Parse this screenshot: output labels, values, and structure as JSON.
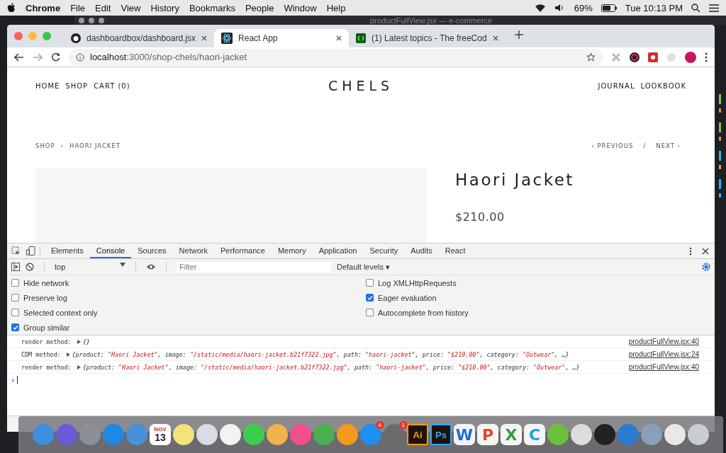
{
  "menubar": {
    "app": "Chrome",
    "items": [
      "File",
      "Edit",
      "View",
      "History",
      "Bookmarks",
      "People",
      "Window",
      "Help"
    ],
    "battery": "69%",
    "clock": "Tue 10:13 PM"
  },
  "background_window": {
    "title": "productFullView.jsx — e-commerce"
  },
  "browser": {
    "tabs": [
      {
        "title": "dashboardbox/dashboard.jsx",
        "selected": false
      },
      {
        "title": "React App",
        "selected": true
      },
      {
        "title": "(1) Latest topics - The freeCod",
        "selected": false
      }
    ],
    "url_host": "localhost",
    "url_path": ":3000/shop-chels/haori-jacket"
  },
  "page": {
    "nav_left": [
      "HOME",
      "SHOP",
      "CART (0)"
    ],
    "logo": "CHELS",
    "nav_right": [
      "JOURNAL",
      "LOOKBOOK"
    ],
    "breadcrumb": [
      "SHOP",
      "HAORI JACKET"
    ],
    "breadcrumb_sep": "›",
    "previous": "‹ PREVIOUS",
    "pager_sep": "/",
    "next": "NEXT ›",
    "product": {
      "name": "Haori Jacket",
      "price": "$210.00"
    }
  },
  "devtools": {
    "tabs": [
      {
        "label": "Elements",
        "selected": false
      },
      {
        "label": "Console",
        "selected": true
      },
      {
        "label": "Sources",
        "selected": false
      },
      {
        "label": "Network",
        "selected": false
      },
      {
        "label": "Performance",
        "selected": false
      },
      {
        "label": "Memory",
        "selected": false
      },
      {
        "label": "Application",
        "selected": false
      },
      {
        "label": "Security",
        "selected": false
      },
      {
        "label": "Audits",
        "selected": false
      },
      {
        "label": "React",
        "selected": false
      }
    ],
    "context": "top",
    "filter_placeholder": "Filter",
    "levels": "Default levels ▾",
    "settings_left": [
      {
        "label": "Hide network",
        "checked": false
      },
      {
        "label": "Preserve log",
        "checked": false
      },
      {
        "label": "Selected context only",
        "checked": false
      },
      {
        "label": "Group similar",
        "checked": true
      }
    ],
    "settings_right": [
      {
        "label": "Log XMLHttpRequests",
        "checked": false
      },
      {
        "label": "Eager evaluation",
        "checked": true
      },
      {
        "label": "Autocomplete from history",
        "checked": false
      }
    ],
    "logs": [
      {
        "prefix": "render method: ",
        "segments": [
          {
            "kind": "punct",
            "text": "{}"
          }
        ],
        "source": "productFullView.jsx:40"
      },
      {
        "prefix": "CDM method: ",
        "segments": [
          {
            "kind": "punct",
            "text": "{"
          },
          {
            "kind": "key",
            "text": "product: "
          },
          {
            "kind": "string",
            "text": "\"Haori Jacket\""
          },
          {
            "kind": "key",
            "text": ", image: "
          },
          {
            "kind": "string",
            "text": "\"/static/media/haori-jacket.b21f7322.jpg\""
          },
          {
            "kind": "key",
            "text": ", path: "
          },
          {
            "kind": "string",
            "text": "\"haori-jacket\""
          },
          {
            "kind": "key",
            "text": ", price: "
          },
          {
            "kind": "string",
            "text": "\"$210.00\""
          },
          {
            "kind": "key",
            "text": ", category: "
          },
          {
            "kind": "string",
            "text": "\"Outwear\""
          },
          {
            "kind": "punct",
            "text": ", …}"
          }
        ],
        "source": "productFullView.jsx:24"
      },
      {
        "prefix": "render method: ",
        "segments": [
          {
            "kind": "punct",
            "text": "{"
          },
          {
            "kind": "key",
            "text": "product: "
          },
          {
            "kind": "string",
            "text": "\"Haori Jacket\""
          },
          {
            "kind": "key",
            "text": ", image: "
          },
          {
            "kind": "string",
            "text": "\"/static/media/haori-jacket.b21f7322.jpg\""
          },
          {
            "kind": "key",
            "text": ", path: "
          },
          {
            "kind": "string",
            "text": "\"haori-jacket\""
          },
          {
            "kind": "key",
            "text": ", price: "
          },
          {
            "kind": "string",
            "text": "\"$210.00\""
          },
          {
            "kind": "key",
            "text": ", category: "
          },
          {
            "kind": "string",
            "text": "\"Outwear\""
          },
          {
            "kind": "punct",
            "text": ", …}"
          }
        ],
        "source": "productFullView.jsx:40"
      }
    ],
    "prompt": "›"
  },
  "dock": [
    {
      "kind": "app",
      "color": "#3d8fe0"
    },
    {
      "kind": "app",
      "color": "#6a5bd6"
    },
    {
      "kind": "app",
      "color": "#8a8f98"
    },
    {
      "kind": "app",
      "color": "#1e88e5"
    },
    {
      "kind": "app",
      "color": "#4a90d9"
    },
    {
      "kind": "calendar",
      "color": "#ffffff",
      "label": "13",
      "caption": "NOV"
    },
    {
      "kind": "app",
      "color": "#f4e27a"
    },
    {
      "kind": "app",
      "color": "#d9dde3"
    },
    {
      "kind": "app",
      "color": "#f3f3f3"
    },
    {
      "kind": "app",
      "color": "#3ccf4e"
    },
    {
      "kind": "app",
      "color": "#f0b24a"
    },
    {
      "kind": "app",
      "color": "#f24f8b"
    },
    {
      "kind": "app",
      "color": "#4caf50"
    },
    {
      "kind": "app",
      "color": "#f39a1d"
    },
    {
      "kind": "app",
      "color": "#1f8ff0",
      "badge": "4"
    },
    {
      "kind": "app",
      "color": "#6b6b6b",
      "badge": "1"
    },
    {
      "kind": "letter",
      "color": "#ff9a00",
      "label": "Ai"
    },
    {
      "kind": "letter",
      "color": "#31a8ff",
      "label": "Ps"
    },
    {
      "kind": "glyph",
      "color": "#1e6fd0",
      "label": "W"
    },
    {
      "kind": "glyph",
      "color": "#e0452a",
      "label": "P"
    },
    {
      "kind": "glyph",
      "color": "#2ea043",
      "label": "X"
    },
    {
      "kind": "glyph",
      "color": "#1aa3d8",
      "label": "C"
    },
    {
      "kind": "app",
      "color": "#6cbf3a"
    },
    {
      "kind": "app",
      "color": "#dcdcdc"
    },
    {
      "kind": "app",
      "color": "#222222"
    },
    {
      "kind": "app",
      "color": "#2b7bd0"
    },
    {
      "kind": "app",
      "color": "#8aa0b8"
    },
    {
      "kind": "app",
      "color": "#e8e8e8"
    },
    {
      "kind": "app",
      "color": "#c9ccd1"
    }
  ]
}
